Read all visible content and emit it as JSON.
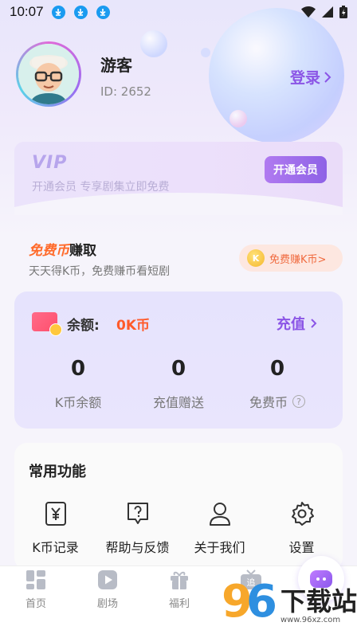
{
  "status_bar": {
    "time": "10:07"
  },
  "profile": {
    "name": "游客",
    "id_text": "ID: 2652",
    "login_label": "登录"
  },
  "vip": {
    "logo": "VIP",
    "description": "开通会员  专享剧集立即免费",
    "button_label": "开通会员"
  },
  "free_coins": {
    "title_highlight": "免费币",
    "title_rest": "赚取",
    "subtitle": "天天得K币，免费赚币看短剧",
    "button_label": "免费赚K币>",
    "coin_glyph": "K"
  },
  "balance": {
    "label": "余额:",
    "value": "0K币",
    "recharge_label": "充值",
    "stats": [
      {
        "value": "0",
        "label": "K币余额"
      },
      {
        "value": "0",
        "label": "充值赠送"
      },
      {
        "value": "0",
        "label": "免费币"
      }
    ],
    "help_glyph": "?"
  },
  "functions": {
    "title": "常用功能",
    "items": [
      {
        "label": "K币记录",
        "icon": "yen-record-icon"
      },
      {
        "label": "帮助与反馈",
        "icon": "help-icon"
      },
      {
        "label": "关于我们",
        "icon": "person-icon"
      },
      {
        "label": "设置",
        "icon": "gear-icon"
      }
    ]
  },
  "tabbar": {
    "items": [
      {
        "label": "首页",
        "icon": "home-grid-icon"
      },
      {
        "label": "剧场",
        "icon": "play-icon"
      },
      {
        "label": "福利",
        "icon": "gift-icon"
      },
      {
        "label": "",
        "icon": "tv-follow-icon",
        "badge": "追"
      }
    ]
  },
  "watermark": {
    "num9": "9",
    "num6": "6",
    "text": "下载站",
    "url": "www.96xz.com"
  },
  "colors": {
    "accent_purple": "#8b55e6",
    "accent_orange": "#ff5a2a",
    "vip_button": "#9a6be9"
  }
}
